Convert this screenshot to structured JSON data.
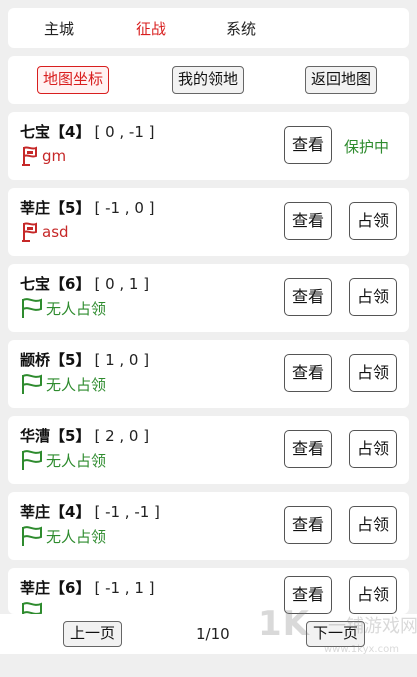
{
  "tabs": [
    {
      "label": "主城",
      "active": false
    },
    {
      "label": "征战",
      "active": true
    },
    {
      "label": "系统",
      "active": false
    }
  ],
  "toolbar": {
    "map_coords": "地图坐标",
    "my_territory": "我的领地",
    "back_to_map": "返回地图"
  },
  "territories": [
    {
      "name": "七宝",
      "level": "【4】",
      "coord": "[ 0 , -1 ]",
      "owner": "gm",
      "flag": "red-flag-icon",
      "view": "查看",
      "status": "保护中"
    },
    {
      "name": "莘庄",
      "level": "【5】",
      "coord": "[ -1 , 0 ]",
      "owner": "asd",
      "flag": "red-flag-icon",
      "view": "查看",
      "occupy": "占领"
    },
    {
      "name": "七宝",
      "level": "【6】",
      "coord": "[ 0 , 1 ]",
      "owner": "无人占领",
      "flag": "green-flag-icon",
      "view": "查看",
      "occupy": "占领"
    },
    {
      "name": "颛桥",
      "level": "【5】",
      "coord": "[ 1 , 0 ]",
      "owner": "无人占领",
      "flag": "green-flag-icon",
      "view": "查看",
      "occupy": "占领"
    },
    {
      "name": "华漕",
      "level": "【5】",
      "coord": "[ 2 , 0 ]",
      "owner": "无人占领",
      "flag": "green-flag-icon",
      "view": "查看",
      "occupy": "占领"
    },
    {
      "name": "莘庄",
      "level": "【4】",
      "coord": "[ -1 , -1 ]",
      "owner": "无人占领",
      "flag": "green-flag-icon",
      "view": "查看",
      "occupy": "占领"
    },
    {
      "name": "莘庄",
      "level": "【6】",
      "coord": "[ -1 , 1 ]",
      "owner": "",
      "flag": "green-flag-icon",
      "view": "查看",
      "occupy": "占领"
    }
  ],
  "pager": {
    "prev": "上一页",
    "info": "1/10",
    "next": "下一页"
  },
  "watermark": {
    "main": "1K",
    "cn": "一铺游戏网",
    "url": "www.1kyx.com"
  },
  "colors": {
    "active_red": "#d81e1e",
    "owned_red": "#c62828",
    "free_green": "#2e8b2e",
    "background": "#efefef"
  }
}
